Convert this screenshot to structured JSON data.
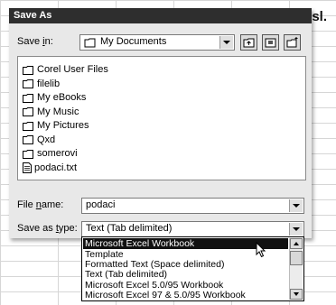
{
  "background": {
    "corner_text": "sl."
  },
  "dialog": {
    "title": "Save As",
    "save_in": {
      "label_pre": "Save ",
      "label_ul": "i",
      "label_post": "n:",
      "value": "My Documents"
    },
    "toolbar": {
      "icons": [
        "up-folder-icon",
        "desktop-icon",
        "new-folder-icon"
      ]
    },
    "files": [
      {
        "name": "Corel User Files",
        "type": "folder"
      },
      {
        "name": "filelib",
        "type": "folder"
      },
      {
        "name": "My eBooks",
        "type": "folder"
      },
      {
        "name": "My Music",
        "type": "folder"
      },
      {
        "name": "My Pictures",
        "type": "folder"
      },
      {
        "name": "Qxd",
        "type": "folder"
      },
      {
        "name": "somerovi",
        "type": "folder"
      },
      {
        "name": "podaci.txt",
        "type": "text-file"
      }
    ],
    "file_name": {
      "label_pre": "File ",
      "label_ul": "n",
      "label_post": "ame:",
      "value": "podaci"
    },
    "save_as_type": {
      "label_pre": "Save as ",
      "label_ul": "t",
      "label_post": "ype:",
      "value": "Text (Tab delimited)",
      "options": [
        "Microsoft Excel Workbook",
        "Template",
        "Formatted Text (Space delimited)",
        "Text (Tab delimited)",
        "Microsoft Excel 5.0/95 Workbook",
        "Microsoft Excel 97 & 5.0/95 Workbook"
      ],
      "highlighted_option": "Microsoft Excel Workbook"
    }
  },
  "colors": {
    "titlebar": "#2e2e2e",
    "dialog_bg": "#e8e8e8",
    "selection": "#111111"
  }
}
